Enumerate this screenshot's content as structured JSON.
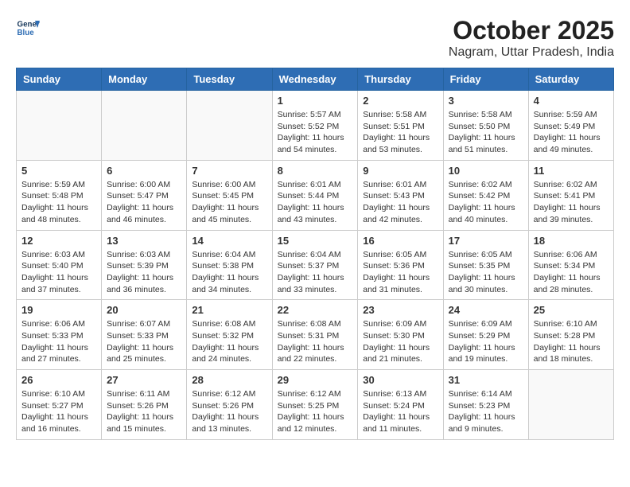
{
  "header": {
    "logo_general": "General",
    "logo_blue": "Blue",
    "month_year": "October 2025",
    "location": "Nagram, Uttar Pradesh, India"
  },
  "weekdays": [
    "Sunday",
    "Monday",
    "Tuesday",
    "Wednesday",
    "Thursday",
    "Friday",
    "Saturday"
  ],
  "weeks": [
    [
      {
        "day": "",
        "info": ""
      },
      {
        "day": "",
        "info": ""
      },
      {
        "day": "",
        "info": ""
      },
      {
        "day": "1",
        "info": "Sunrise: 5:57 AM\nSunset: 5:52 PM\nDaylight: 11 hours\nand 54 minutes."
      },
      {
        "day": "2",
        "info": "Sunrise: 5:58 AM\nSunset: 5:51 PM\nDaylight: 11 hours\nand 53 minutes."
      },
      {
        "day": "3",
        "info": "Sunrise: 5:58 AM\nSunset: 5:50 PM\nDaylight: 11 hours\nand 51 minutes."
      },
      {
        "day": "4",
        "info": "Sunrise: 5:59 AM\nSunset: 5:49 PM\nDaylight: 11 hours\nand 49 minutes."
      }
    ],
    [
      {
        "day": "5",
        "info": "Sunrise: 5:59 AM\nSunset: 5:48 PM\nDaylight: 11 hours\nand 48 minutes."
      },
      {
        "day": "6",
        "info": "Sunrise: 6:00 AM\nSunset: 5:47 PM\nDaylight: 11 hours\nand 46 minutes."
      },
      {
        "day": "7",
        "info": "Sunrise: 6:00 AM\nSunset: 5:45 PM\nDaylight: 11 hours\nand 45 minutes."
      },
      {
        "day": "8",
        "info": "Sunrise: 6:01 AM\nSunset: 5:44 PM\nDaylight: 11 hours\nand 43 minutes."
      },
      {
        "day": "9",
        "info": "Sunrise: 6:01 AM\nSunset: 5:43 PM\nDaylight: 11 hours\nand 42 minutes."
      },
      {
        "day": "10",
        "info": "Sunrise: 6:02 AM\nSunset: 5:42 PM\nDaylight: 11 hours\nand 40 minutes."
      },
      {
        "day": "11",
        "info": "Sunrise: 6:02 AM\nSunset: 5:41 PM\nDaylight: 11 hours\nand 39 minutes."
      }
    ],
    [
      {
        "day": "12",
        "info": "Sunrise: 6:03 AM\nSunset: 5:40 PM\nDaylight: 11 hours\nand 37 minutes."
      },
      {
        "day": "13",
        "info": "Sunrise: 6:03 AM\nSunset: 5:39 PM\nDaylight: 11 hours\nand 36 minutes."
      },
      {
        "day": "14",
        "info": "Sunrise: 6:04 AM\nSunset: 5:38 PM\nDaylight: 11 hours\nand 34 minutes."
      },
      {
        "day": "15",
        "info": "Sunrise: 6:04 AM\nSunset: 5:37 PM\nDaylight: 11 hours\nand 33 minutes."
      },
      {
        "day": "16",
        "info": "Sunrise: 6:05 AM\nSunset: 5:36 PM\nDaylight: 11 hours\nand 31 minutes."
      },
      {
        "day": "17",
        "info": "Sunrise: 6:05 AM\nSunset: 5:35 PM\nDaylight: 11 hours\nand 30 minutes."
      },
      {
        "day": "18",
        "info": "Sunrise: 6:06 AM\nSunset: 5:34 PM\nDaylight: 11 hours\nand 28 minutes."
      }
    ],
    [
      {
        "day": "19",
        "info": "Sunrise: 6:06 AM\nSunset: 5:33 PM\nDaylight: 11 hours\nand 27 minutes."
      },
      {
        "day": "20",
        "info": "Sunrise: 6:07 AM\nSunset: 5:33 PM\nDaylight: 11 hours\nand 25 minutes."
      },
      {
        "day": "21",
        "info": "Sunrise: 6:08 AM\nSunset: 5:32 PM\nDaylight: 11 hours\nand 24 minutes."
      },
      {
        "day": "22",
        "info": "Sunrise: 6:08 AM\nSunset: 5:31 PM\nDaylight: 11 hours\nand 22 minutes."
      },
      {
        "day": "23",
        "info": "Sunrise: 6:09 AM\nSunset: 5:30 PM\nDaylight: 11 hours\nand 21 minutes."
      },
      {
        "day": "24",
        "info": "Sunrise: 6:09 AM\nSunset: 5:29 PM\nDaylight: 11 hours\nand 19 minutes."
      },
      {
        "day": "25",
        "info": "Sunrise: 6:10 AM\nSunset: 5:28 PM\nDaylight: 11 hours\nand 18 minutes."
      }
    ],
    [
      {
        "day": "26",
        "info": "Sunrise: 6:10 AM\nSunset: 5:27 PM\nDaylight: 11 hours\nand 16 minutes."
      },
      {
        "day": "27",
        "info": "Sunrise: 6:11 AM\nSunset: 5:26 PM\nDaylight: 11 hours\nand 15 minutes."
      },
      {
        "day": "28",
        "info": "Sunrise: 6:12 AM\nSunset: 5:26 PM\nDaylight: 11 hours\nand 13 minutes."
      },
      {
        "day": "29",
        "info": "Sunrise: 6:12 AM\nSunset: 5:25 PM\nDaylight: 11 hours\nand 12 minutes."
      },
      {
        "day": "30",
        "info": "Sunrise: 6:13 AM\nSunset: 5:24 PM\nDaylight: 11 hours\nand 11 minutes."
      },
      {
        "day": "31",
        "info": "Sunrise: 6:14 AM\nSunset: 5:23 PM\nDaylight: 11 hours\nand 9 minutes."
      },
      {
        "day": "",
        "info": ""
      }
    ]
  ]
}
